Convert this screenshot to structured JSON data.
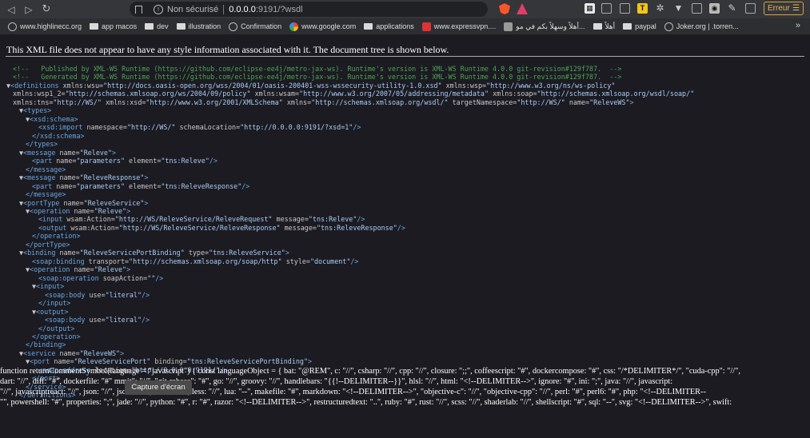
{
  "toolbar": {
    "security_label": "Non sécurisé",
    "url_host": "0.0.0.0",
    "url_rest": ":9191/?wsdl",
    "error_label": "Erreur"
  },
  "icons": {
    "back": "chevron-left",
    "forward": "play-right",
    "reload": "reload",
    "bookmark": "bookmark",
    "insecure": "warning-circle",
    "menu": "hamburger"
  },
  "bookmarks": [
    {
      "label": "www.highlinecc.org",
      "icon": "globe"
    },
    {
      "label": "app macos",
      "icon": "folder"
    },
    {
      "label": "dev",
      "icon": "folder"
    },
    {
      "label": "illustration",
      "icon": "folder"
    },
    {
      "label": "Confirmation",
      "icon": "globe"
    },
    {
      "label": "www.google.com",
      "icon": "google"
    },
    {
      "label": "applications",
      "icon": "folder"
    },
    {
      "label": "www.expressvpn....",
      "icon": "express"
    },
    {
      "label": "أهلاً وسهلاً بكم في مو...",
      "icon": "grey"
    },
    {
      "label": "أهلاً",
      "icon": "folder"
    },
    {
      "label": "paypal",
      "icon": "folder"
    },
    {
      "label": "Joker.org | .torren...",
      "icon": "globe"
    }
  ],
  "bookmarks_more": "»",
  "content": {
    "notice": "This XML file does not appear to have any style information associated with it. The document tree is shown below."
  },
  "xml_lines": [
    {
      "html": "<span class='c'>&lt;!--   Published by XML-WS Runtime (https://github.com/eclipse-ee4j/metro-jax-ws). Runtime's version is XML-WS Runtime 4.0.0 git-revision#129f787.  --&gt;</span>",
      "indent": 1
    },
    {
      "html": "<span class='c'>&lt;!--   Generated by XML-WS Runtime (https://github.com/eclipse-ee4j/metro-jax-ws). Runtime's version is XML-WS Runtime 4.0.0 git-revision#129f787.  --&gt;</span>",
      "indent": 1
    },
    {
      "html": "<span class='tri'>▼</span><span class='t'>&lt;definitions</span> <span class='a'>xmlns:wsu=</span><span class='v'>\"http://docs.oasis-open.org/wss/2004/01/oasis-200401-wss-wssecurity-utility-1.0.xsd\"</span> <span class='a'>xmlns:wsp=</span><span class='v'>\"http://www.w3.org/ns/ws-policy\"</span>",
      "indent": 0
    },
    {
      "html": "<span class='a'>xmlns:wsp1_2=</span><span class='v'>\"http://schemas.xmlsoap.org/ws/2004/09/policy\"</span> <span class='a'>xmlns:wsam=</span><span class='v'>\"http://www.w3.org/2007/05/addressing/metadata\"</span> <span class='a'>xmlns:soap=</span><span class='v'>\"http://schemas.xmlsoap.org/wsdl/soap/\"</span>",
      "indent": 1
    },
    {
      "html": "<span class='a'>xmlns:tns=</span><span class='v'>\"http://WS/\"</span> <span class='a'>xmlns:xsd=</span><span class='v'>\"http://www.w3.org/2001/XMLSchema\"</span> <span class='a'>xmlns=</span><span class='v'>\"http://schemas.xmlsoap.org/wsdl/\"</span> <span class='a'>targetNamespace=</span><span class='v'>\"http://WS/\"</span> <span class='a'>name=</span><span class='v'>\"ReleveWS\"</span><span class='t'>&gt;</span>",
      "indent": 1
    },
    {
      "html": "<span class='tri'>▼</span><span class='t'>&lt;types&gt;</span>",
      "indent": 2
    },
    {
      "html": "<span class='tri'>▼</span><span class='t'>&lt;xsd:schema&gt;</span>",
      "indent": 3
    },
    {
      "html": "<span class='t'>&lt;xsd:import</span> <span class='a'>namespace=</span><span class='v'>\"http://WS/\"</span> <span class='a'>schemaLocation=</span><span class='v'>\"http://0.0.0.0:9191/?xsd=1\"</span><span class='t'>/&gt;</span>",
      "indent": 5
    },
    {
      "html": "<span class='t'>&lt;/xsd:schema&gt;</span>",
      "indent": 4
    },
    {
      "html": "<span class='t'>&lt;/types&gt;</span>",
      "indent": 3
    },
    {
      "html": "<span class='tri'>▼</span><span class='t'>&lt;message</span> <span class='a'>name=</span><span class='v'>\"Releve\"</span><span class='t'>&gt;</span>",
      "indent": 2
    },
    {
      "html": "<span class='t'>&lt;part</span> <span class='a'>name=</span><span class='v'>\"parameters\"</span> <span class='a'>element=</span><span class='v'>\"tns:Releve\"</span><span class='t'>/&gt;</span>",
      "indent": 4
    },
    {
      "html": "<span class='t'>&lt;/message&gt;</span>",
      "indent": 3
    },
    {
      "html": "<span class='tri'>▼</span><span class='t'>&lt;message</span> <span class='a'>name=</span><span class='v'>\"ReleveResponse\"</span><span class='t'>&gt;</span>",
      "indent": 2
    },
    {
      "html": "<span class='t'>&lt;part</span> <span class='a'>name=</span><span class='v'>\"parameters\"</span> <span class='a'>element=</span><span class='v'>\"tns:ReleveResponse\"</span><span class='t'>/&gt;</span>",
      "indent": 4
    },
    {
      "html": "<span class='t'>&lt;/message&gt;</span>",
      "indent": 3
    },
    {
      "html": "<span class='tri'>▼</span><span class='t'>&lt;portType</span> <span class='a'>name=</span><span class='v'>\"ReleveService\"</span><span class='t'>&gt;</span>",
      "indent": 2
    },
    {
      "html": "<span class='tri'>▼</span><span class='t'>&lt;operation</span> <span class='a'>name=</span><span class='v'>\"Releve\"</span><span class='t'>&gt;</span>",
      "indent": 3
    },
    {
      "html": "<span class='t'>&lt;input</span> <span class='a'>wsam:Action=</span><span class='v'>\"http://WS/ReleveService/ReleveRequest\"</span> <span class='a'>message=</span><span class='v'>\"tns:Releve\"</span><span class='t'>/&gt;</span>",
      "indent": 5
    },
    {
      "html": "<span class='t'>&lt;output</span> <span class='a'>wsam:Action=</span><span class='v'>\"http://WS/ReleveService/ReleveResponse\"</span> <span class='a'>message=</span><span class='v'>\"tns:ReleveResponse\"</span><span class='t'>/&gt;</span>",
      "indent": 5
    },
    {
      "html": "<span class='t'>&lt;/operation&gt;</span>",
      "indent": 4
    },
    {
      "html": "<span class='t'>&lt;/portType&gt;</span>",
      "indent": 3
    },
    {
      "html": "<span class='tri'>▼</span><span class='t'>&lt;binding</span> <span class='a'>name=</span><span class='v'>\"ReleveServicePortBinding\"</span> <span class='a'>type=</span><span class='v'>\"tns:ReleveService\"</span><span class='t'>&gt;</span>",
      "indent": 2
    },
    {
      "html": "<span class='t'>&lt;soap:binding</span> <span class='a'>transport=</span><span class='v'>\"http://schemas.xmlsoap.org/soap/http\"</span> <span class='a'>style=</span><span class='v'>\"document\"</span><span class='t'>/&gt;</span>",
      "indent": 4
    },
    {
      "html": "<span class='tri'>▼</span><span class='t'>&lt;operation</span> <span class='a'>name=</span><span class='v'>\"Releve\"</span><span class='t'>&gt;</span>",
      "indent": 3
    },
    {
      "html": "<span class='t'>&lt;soap:operation</span> <span class='a'>soapAction=</span><span class='v'>\"\"</span><span class='t'>/&gt;</span>",
      "indent": 5
    },
    {
      "html": "<span class='tri'>▼</span><span class='t'>&lt;input&gt;</span>",
      "indent": 4
    },
    {
      "html": "<span class='t'>&lt;soap:body</span> <span class='a'>use=</span><span class='v'>\"literal\"</span><span class='t'>/&gt;</span>",
      "indent": 6
    },
    {
      "html": "<span class='t'>&lt;/input&gt;</span>",
      "indent": 5
    },
    {
      "html": "<span class='tri'>▼</span><span class='t'>&lt;output&gt;</span>",
      "indent": 4
    },
    {
      "html": "<span class='t'>&lt;soap:body</span> <span class='a'>use=</span><span class='v'>\"literal\"</span><span class='t'>/&gt;</span>",
      "indent": 6
    },
    {
      "html": "<span class='t'>&lt;/output&gt;</span>",
      "indent": 5
    },
    {
      "html": "<span class='t'>&lt;/operation&gt;</span>",
      "indent": 4
    },
    {
      "html": "<span class='t'>&lt;/binding&gt;</span>",
      "indent": 3
    },
    {
      "html": "<span class='tri'>▼</span><span class='t'>&lt;service</span> <span class='a'>name=</span><span class='v'>\"ReleveWS\"</span><span class='t'>&gt;</span>",
      "indent": 2
    },
    {
      "html": "<span class='tri'>▼</span><span class='t'>&lt;port</span> <span class='a'>name=</span><span class='v'>\"ReleveServicePort\"</span> <span class='a'>binding=</span><span class='v'>\"tns:ReleveServicePortBinding\"</span><span class='t'>&gt;</span>",
      "indent": 3
    },
    {
      "html": "<span class='t'>&lt;soap:address</span> <span class='a'>location=</span><span class='v'>\"http://0.0.0.0:9191/\"</span><span class='t'>/&gt;</span>",
      "indent": 5
    },
    {
      "html": "<span class='t'>&lt;/port&gt;</span>",
      "indent": 4
    },
    {
      "html": "<span class='t'>&lt;/service&gt;</span>",
      "indent": 3
    },
    {
      "html": "<span class='t'>&lt;/definitions&gt;</span>",
      "indent": 2
    }
  ],
  "js_lines": [
    "function returnCommentSymbol(language = \"javascript\") { const languageObject = { bat: \"@REM\", c: \"//\", csharp: \"//\", cpp: \"//\", closure: \";;\", coffeescript: \"#\", dockercompose: \"#\", css: \"/*DELIMITER*/\", \"cuda-cpp\": \"//\",",
    "dart: \"//\", diff: \"#\", dockerfile: \"#\"                     mmit\": \"//\", \"git-rebase\": \"#\", go: \"//\", groovy: \"//\", handlebars: \"{{!--DELIMITER--}}\", hlsl: \"//\", html: \"<!--DELIMITER-->\", ignore: \"#\", ini: \";\", java: \"//\", javascript:",
    "\"//\", javascriptreact: \"//\", json: \"//\", jsonc: \"//\", latex: \"%\", less: \"//\", lua: \"--\", makefile: \"#\", markdown: \"<!--DELIMITER-->\", \"objective-c\": \"//\", \"objective-cpp\": \"//\", perl: \"#\", perl6: \"#\", php: \"<!--DELIMITER--",
    "\"\", powershell: \"#\", properties: \";\", jade: \"//\", python: \"#\", r: \"#\", razor: \"<!--DELIMITER-->\", restructuredtext: \"..\", ruby: \"#\", rust: \"//\", scss: \"//\", shaderlab: \"//\", shellscript: \"#\", sql: \"--\", svg: \"<!--DELIMITER-->\", swift:"
  ],
  "tooltip": "Capture d'écran"
}
